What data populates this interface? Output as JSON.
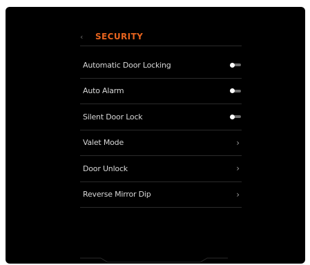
{
  "header": {
    "back_icon": "‹",
    "title": "SECURITY"
  },
  "colors": {
    "accent": "#e8641e",
    "background": "#000000",
    "text": "#d8d8d8"
  },
  "settings": [
    {
      "label": "Automatic Door Locking",
      "control": "toggle",
      "state": "on"
    },
    {
      "label": "Auto Alarm",
      "control": "toggle",
      "state": "on"
    },
    {
      "label": "Silent Door Lock",
      "control": "toggle",
      "state": "on"
    },
    {
      "label": "Valet Mode",
      "control": "chevron",
      "icon": "chevron-right-icon"
    },
    {
      "label": "Door Unlock",
      "control": "chevron",
      "icon": "chevron-right-icon"
    },
    {
      "label": "Reverse Mirror Dip",
      "control": "chevron",
      "icon": "chevron-right-icon"
    }
  ],
  "chevron_glyph": "›"
}
